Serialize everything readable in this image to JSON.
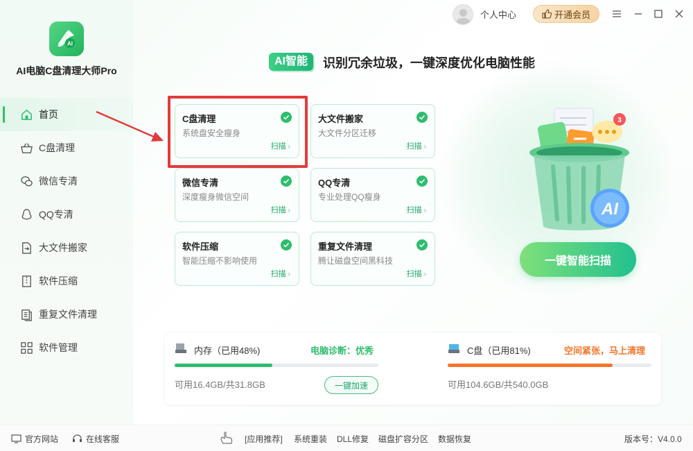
{
  "app": {
    "name": "AI电脑C盘清理大师Pro"
  },
  "topbar": {
    "user_center": "个人中心",
    "vip_label": "开通会员"
  },
  "sidebar": {
    "items": [
      {
        "label": "首页",
        "icon": "home-icon"
      },
      {
        "label": "C盘清理",
        "icon": "basket-icon"
      },
      {
        "label": "微信专清",
        "icon": "wechat-icon"
      },
      {
        "label": "QQ专清",
        "icon": "qq-icon"
      },
      {
        "label": "大文件搬家",
        "icon": "move-file-icon"
      },
      {
        "label": "软件压缩",
        "icon": "compress-icon"
      },
      {
        "label": "重复文件清理",
        "icon": "duplicate-file-icon"
      },
      {
        "label": "软件管理",
        "icon": "apps-grid-icon"
      }
    ]
  },
  "headline": {
    "badge": "AI智能",
    "text": "识别冗余垃圾，一键深度优化电脑性能"
  },
  "cards": [
    {
      "title": "C盘清理",
      "desc": "系统盘安全瘦身",
      "action": "扫描"
    },
    {
      "title": "大文件搬家",
      "desc": "大文件分区迁移",
      "action": "扫描"
    },
    {
      "title": "微信专清",
      "desc": "深度瘦身微信空间",
      "action": "扫描"
    },
    {
      "title": "QQ专清",
      "desc": "专业处理QQ瘦身",
      "action": "扫描"
    },
    {
      "title": "软件压缩",
      "desc": "智能压缩不影响使用",
      "action": "扫描"
    },
    {
      "title": "重复文件清理",
      "desc": "腾让磁盘空间黑科技",
      "action": "扫描"
    }
  ],
  "scan_button": "一键智能扫描",
  "status": {
    "memory": {
      "label": "内存（已用48%)",
      "diagnosis": "电脑诊断：优秀",
      "used_percent": 48,
      "detail": "可用16.4GB/共31.8GB",
      "action": "一键加速",
      "color": "#2dbd6e"
    },
    "disk": {
      "label": "C盘（已用81%)",
      "diagnosis": "空间紧张，马上清理",
      "used_percent": 81,
      "detail": "可用104.6GB/共540.0GB",
      "color": "#f4742b"
    }
  },
  "footer": {
    "website": "官方网站",
    "support": "在线客服",
    "links": [
      "[应用推荐]",
      "系统重装",
      "DLL修复",
      "磁盘扩容分区",
      "数据恢复"
    ],
    "version": "版本号：V4.0.0"
  }
}
